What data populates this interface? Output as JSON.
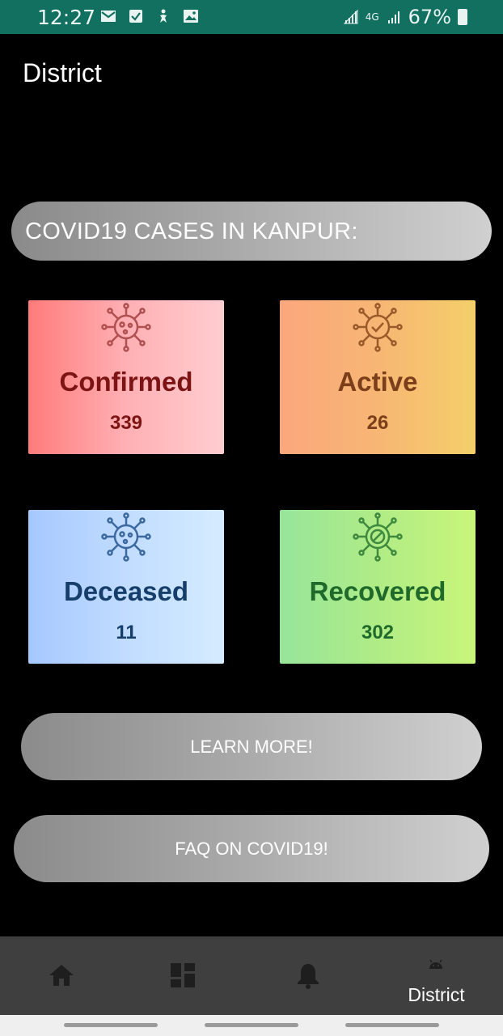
{
  "status_bar": {
    "time": "12:27",
    "network": "4G",
    "battery": "67%",
    "icons_left": [
      "gmail-icon",
      "task-check-icon",
      "accessibility-icon",
      "gallery-icon"
    ]
  },
  "header": {
    "title": "District"
  },
  "summary": {
    "title": "COVID19 CASES IN KANPUR:"
  },
  "cards": [
    {
      "label": "Confirmed",
      "value": "339",
      "color": "#7d1414"
    },
    {
      "label": "Active",
      "value": "26",
      "color": "#7a3f1a"
    },
    {
      "label": "Deceased",
      "value": "11",
      "color": "#163e6b"
    },
    {
      "label": "Recovered",
      "value": "302",
      "color": "#1f6a2b"
    }
  ],
  "buttons": {
    "learn_more": "LEARN MORE!",
    "faq": "FAQ ON COVID19!"
  },
  "bottom_nav": {
    "items": [
      {
        "icon": "home-icon",
        "label": ""
      },
      {
        "icon": "dashboard-icon",
        "label": ""
      },
      {
        "icon": "bell-icon",
        "label": ""
      },
      {
        "icon": "android-icon",
        "label": "District"
      }
    ],
    "active_index": 3
  },
  "colors": {
    "status_bar": "#11705f",
    "background": "#000000",
    "nav_background": "#3f3f3f"
  }
}
